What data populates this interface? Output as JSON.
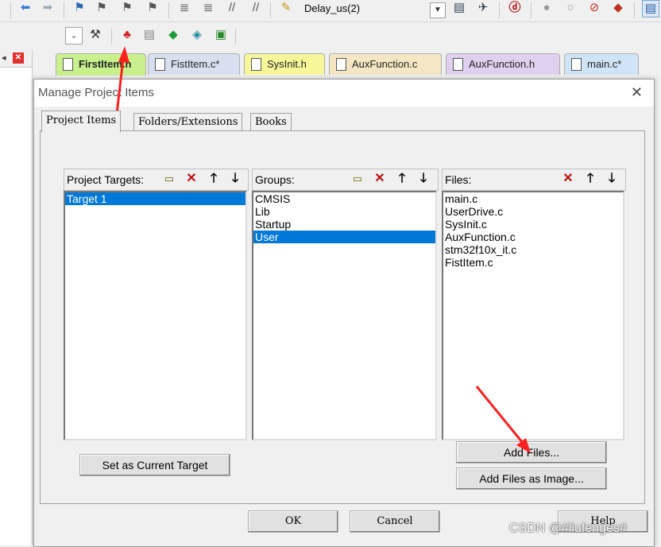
{
  "toolbar": {
    "combo_value": "Delay_us(2)"
  },
  "editor_tabs": [
    {
      "label": "FirstItem.h",
      "bg": "#c8f08c",
      "active": true
    },
    {
      "label": "FistItem.c*",
      "bg": "#d8e0f0",
      "active": false
    },
    {
      "label": "SysInit.h",
      "bg": "#f7f79a",
      "active": false
    },
    {
      "label": "AuxFunction.c",
      "bg": "#f5e6c4",
      "active": false
    },
    {
      "label": "AuxFunction.h",
      "bg": "#e0d0f0",
      "active": false
    },
    {
      "label": "main.c*",
      "bg": "#d0e4f8",
      "active": false
    }
  ],
  "dialog": {
    "title": "Manage Project Items",
    "tabs": [
      "Project Items",
      "Folders/Extensions",
      "Books"
    ],
    "targets": {
      "label": "Project Targets:",
      "items": [
        "Target 1"
      ],
      "selected": 0
    },
    "groups": {
      "label": "Groups:",
      "items": [
        "CMSIS",
        "Lib",
        "Startup",
        "User"
      ],
      "selected": 3
    },
    "files": {
      "label": "Files:",
      "items": [
        "main.c",
        "UserDrive.c",
        "SysInit.c",
        "AuxFunction.c",
        "stm32f10x_it.c",
        "FistItem.c"
      ]
    },
    "buttons": {
      "set_current": "Set as Current Target",
      "add_files": "Add Files...",
      "add_files_image": "Add Files as Image...",
      "ok": "OK",
      "cancel": "Cancel",
      "help": "Help"
    }
  },
  "watermark": "CSDN @#liufenges#",
  "colors": {
    "selection": "#0078d7",
    "annotation_arrow": "#ff2020"
  }
}
